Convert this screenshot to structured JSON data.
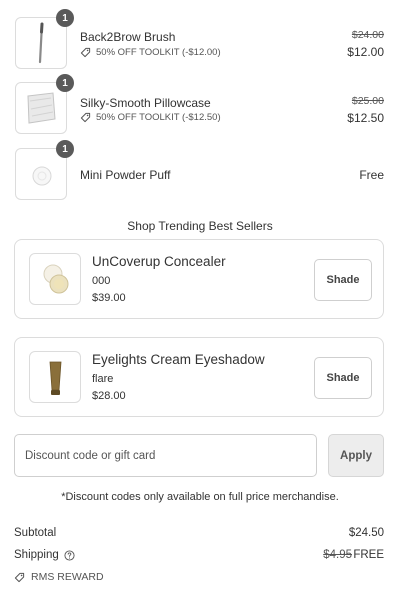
{
  "line_items": [
    {
      "quantity": "1",
      "name": "Back2Brow Brush",
      "discount": "50% OFF TOOLKIT (-$12.00)",
      "original_price": "$24.00",
      "price": "$12.00",
      "image_icon": "brow-brush-icon"
    },
    {
      "quantity": "1",
      "name": "Silky-Smooth Pillowcase",
      "discount": "50% OFF TOOLKIT (-$12.50)",
      "original_price": "$25.00",
      "price": "$12.50",
      "image_icon": "pillowcase-icon"
    },
    {
      "quantity": "1",
      "name": "Mini Powder Puff",
      "price": "Free",
      "image_icon": "powder-puff-icon"
    }
  ],
  "trending": {
    "title": "Shop Trending Best Sellers",
    "items": [
      {
        "name": "UnCoverup Concealer",
        "variant": "000",
        "price": "$39.00",
        "button_label": "Shade",
        "image_icon": "concealer-icon"
      },
      {
        "name": "Eyelights Cream Eyeshadow",
        "variant": "flare",
        "price": "$28.00",
        "button_label": "Shade",
        "image_icon": "eyeshadow-tube-icon"
      }
    ]
  },
  "discount": {
    "placeholder": "Discount code or gift card",
    "value": "",
    "apply_label": "Apply",
    "note": "*Discount codes only available on full price merchandise."
  },
  "summary": {
    "subtotal_label": "Subtotal",
    "subtotal_value": "$24.50",
    "shipping_label": "Shipping",
    "shipping_original": "$4.95",
    "shipping_value": "FREE",
    "reward_label": "RMS REWARD"
  }
}
